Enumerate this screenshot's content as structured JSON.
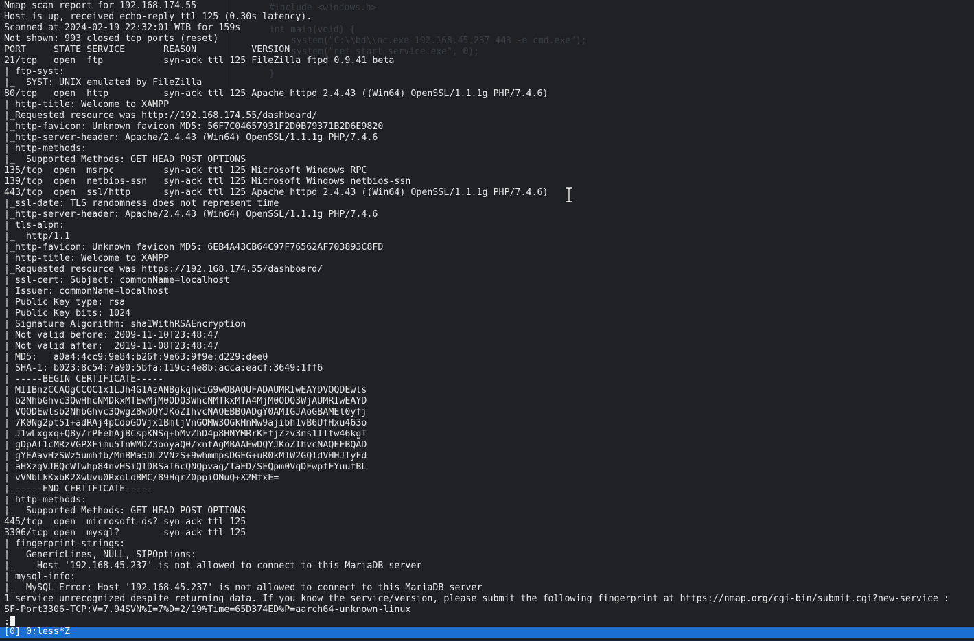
{
  "terminal": {
    "lines": [
      "Nmap scan report for 192.168.174.55",
      "Host is up, received echo-reply ttl 125 (0.30s latency).",
      "Scanned at 2024-02-19 22:32:01 WIB for 159s",
      "Not shown: 993 closed tcp ports (reset)",
      "PORT     STATE SERVICE       REASON          VERSION",
      "21/tcp   open  ftp           syn-ack ttl 125 FileZilla ftpd 0.9.41 beta",
      "| ftp-syst:",
      "|_  SYST: UNIX emulated by FileZilla",
      "80/tcp   open  http          syn-ack ttl 125 Apache httpd 2.4.43 ((Win64) OpenSSL/1.1.1g PHP/7.4.6)",
      "| http-title: Welcome to XAMPP",
      "|_Requested resource was http://192.168.174.55/dashboard/",
      "|_http-favicon: Unknown favicon MD5: 56F7C04657931F2D0B79371B2D6E9820",
      "|_http-server-header: Apache/2.4.43 (Win64) OpenSSL/1.1.1g PHP/7.4.6",
      "| http-methods:",
      "|_  Supported Methods: GET HEAD POST OPTIONS",
      "135/tcp  open  msrpc         syn-ack ttl 125 Microsoft Windows RPC",
      "139/tcp  open  netbios-ssn   syn-ack ttl 125 Microsoft Windows netbios-ssn",
      "443/tcp  open  ssl/http      syn-ack ttl 125 Apache httpd 2.4.43 ((Win64) OpenSSL/1.1.1g PHP/7.4.6)",
      "|_ssl-date: TLS randomness does not represent time",
      "|_http-server-header: Apache/2.4.43 (Win64) OpenSSL/1.1.1g PHP/7.4.6",
      "| tls-alpn:",
      "|_  http/1.1",
      "|_http-favicon: Unknown favicon MD5: 6EB4A43CB64C97F76562AF703893C8FD",
      "| http-title: Welcome to XAMPP",
      "|_Requested resource was https://192.168.174.55/dashboard/",
      "| ssl-cert: Subject: commonName=localhost",
      "| Issuer: commonName=localhost",
      "| Public Key type: rsa",
      "| Public Key bits: 1024",
      "| Signature Algorithm: sha1WithRSAEncryption",
      "| Not valid before: 2009-11-10T23:48:47",
      "| Not valid after:  2019-11-08T23:48:47",
      "| MD5:   a0a4:4cc9:9e84:b26f:9e63:9f9e:d229:dee0",
      "| SHA-1: b023:8c54:7a90:5bfa:119c:4e8b:acca:eacf:3649:1ff6",
      "| -----BEGIN CERTIFICATE-----",
      "| MIIBnzCCAQgCCQC1x1LJh4G1AzANBgkqhkiG9w0BAQUFADAUMRIwEAYDVQQDEwls",
      "| b2NhbGhvc3QwHhcNMDkxMTEwMjM0ODQ3WhcNMTkxMTA4MjM0ODQ3WjAUMRIwEAYD",
      "| VQQDEwlsb2NhbGhvc3QwgZ8wDQYJKoZIhvcNAQEBBQADgY0AMIGJAoGBAMEl0yfj",
      "| 7K0Ng2pt51+adRAj4pCdoGOVjx1BmljVnGOMW3OGkHnMw9ajibh1vB6UfHxu463o",
      "| J1wLxgxq+Q8y/rPEehAjBCspKNSq+bMvZhD4p8HNYMRrKFfjZzv3ns1IItw46kgT",
      "| gDpAl1cMRzVGPXFimu5TnWMOZ3ooyaQ0/xntAgMBAAEwDQYJKoZIhvcNAQEFBQAD",
      "| gYEAavHzSWz5umhfb/MnBMa5DL2VNzS+9whmmpsDGEG+uR0kM1W2GQIdVHHJTyFd",
      "| aHXzgVJBQcWTwhp84nvHSiQTDBSaT6cQNQpvag/TaED/SEQpm0VqDFwpfFYuufBL",
      "| vVNbLkKxbK2XwUvu0RxoLdBMC/89HqrZ0ppiONuQ+X2MtxE=",
      "|_-----END CERTIFICATE-----",
      "| http-methods:",
      "|_  Supported Methods: GET HEAD POST OPTIONS",
      "445/tcp  open  microsoft-ds? syn-ack ttl 125",
      "3306/tcp open  mysql?        syn-ack ttl 125",
      "| fingerprint-strings:",
      "|   GenericLines, NULL, SIPOptions:",
      "|_    Host '192.168.45.237' is not allowed to connect to this MariaDB server",
      "| mysql-info:",
      "|_  MySQL Error: Host '192.168.45.237' is not allowed to connect to this MariaDB server",
      "1 service unrecognized despite returning data. If you know the service/version, please submit the following fingerprint at https://nmap.org/cgi-bin/submit.cgi?new-service :",
      "SF-Port3306-TCP:V=7.94SVN%I=7%D=2/19%Time=65D374ED%P=aarch64-unknown-linux"
    ],
    "prompt": ":",
    "colors": {
      "background": "#1f2124",
      "foreground": "#e8e8e8",
      "status_bar": "#1b6fd1"
    }
  },
  "status_bar": {
    "text": "[0] 0:less*Z"
  }
}
